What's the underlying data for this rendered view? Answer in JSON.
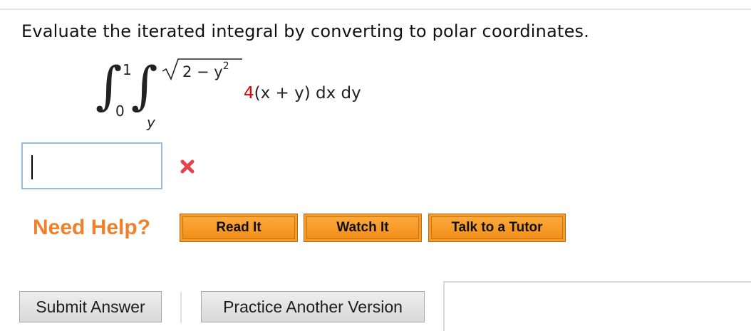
{
  "question": {
    "prompt": "Evaluate the iterated integral by converting to polar coordinates."
  },
  "integral": {
    "outer_upper": "1",
    "outer_lower": "0",
    "inner_upper_radicand": "2 − y",
    "inner_upper_exponent": "2",
    "inner_lower": "y",
    "coefficient": "4",
    "integrand_rest": "(x + y) dx dy",
    "coefficient_color": "#e00000"
  },
  "answer": {
    "value": "",
    "status_icon": "incorrect-x-icon"
  },
  "help": {
    "label": "Need Help?",
    "buttons": [
      "Read It",
      "Watch It",
      "Talk to a Tutor"
    ]
  },
  "actions": {
    "submit_label": "Submit Answer",
    "practice_label": "Practice Another Version"
  },
  "colors": {
    "help_text": "#f0812a",
    "help_button": "#f59b2c",
    "input_border": "#9cbbdc",
    "incorrect_mark": "#e8414e"
  }
}
